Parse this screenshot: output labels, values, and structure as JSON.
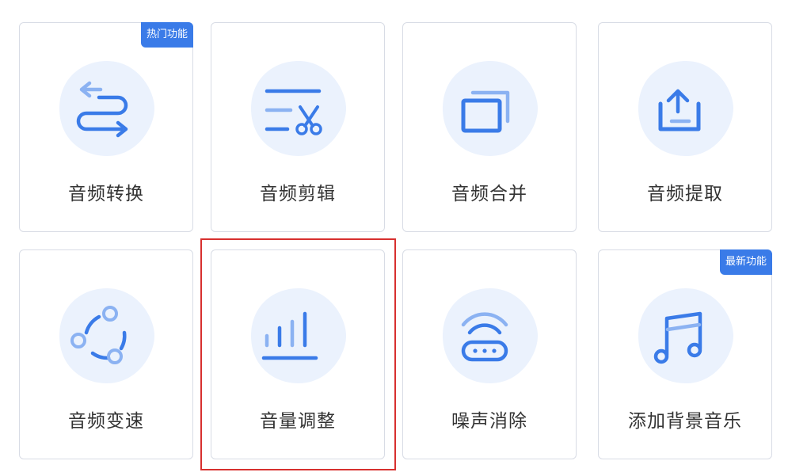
{
  "colors": {
    "accent": "#3a7be8",
    "accent_light": "#8bb2f2",
    "blob": "#ebf2fd",
    "highlight": "#d7302f"
  },
  "tools": [
    {
      "label": "音频转换",
      "icon": "convert-arrows-icon",
      "badge": "热门功能"
    },
    {
      "label": "音频剪辑",
      "icon": "scissors-cut-icon"
    },
    {
      "label": "音频合并",
      "icon": "merge-windows-icon"
    },
    {
      "label": "音频提取",
      "icon": "upload-extract-icon"
    },
    {
      "label": "音频变速",
      "icon": "cycle-speed-icon"
    },
    {
      "label": "音量调整",
      "icon": "volume-bars-icon",
      "selected": true
    },
    {
      "label": "噪声消除",
      "icon": "wifi-router-icon"
    },
    {
      "label": "添加背景音乐",
      "icon": "music-note-icon",
      "badge": "最新功能"
    }
  ]
}
